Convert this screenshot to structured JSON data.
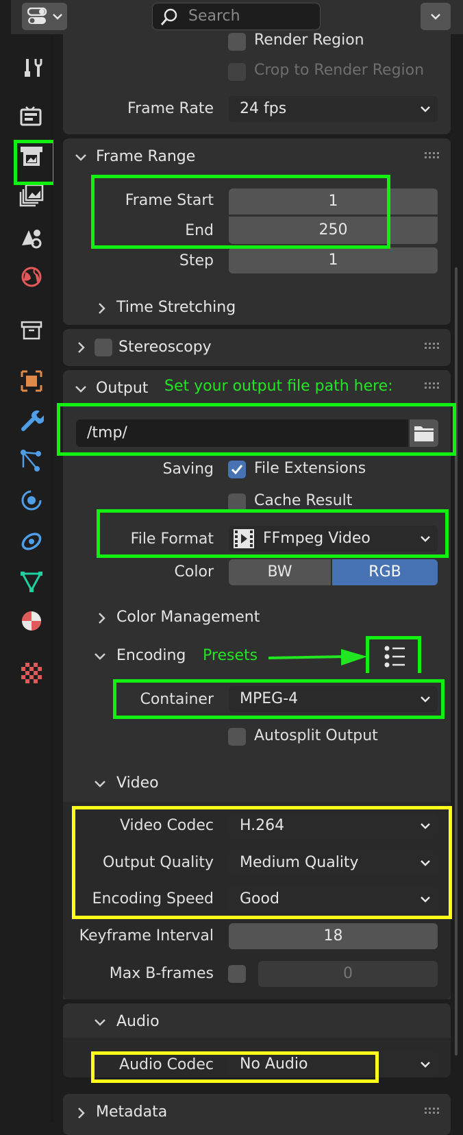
{
  "header": {
    "search_placeholder": "Search"
  },
  "render_region": {
    "render_region_label": "Render Region",
    "crop_label": "Crop to Render Region"
  },
  "format": {
    "frame_rate_label": "Frame Rate",
    "frame_rate_value": "24 fps"
  },
  "frame_range": {
    "title": "Frame Range",
    "start_label": "Frame Start",
    "start_value": "1",
    "end_label": "End",
    "end_value": "250",
    "step_label": "Step",
    "step_value": "1",
    "time_stretching": "Time Stretching"
  },
  "stereoscopy": {
    "title": "Stereoscopy"
  },
  "output": {
    "title": "Output",
    "annotation": "Set your output file path here:",
    "path": "/tmp/",
    "saving_label": "Saving",
    "file_extensions": "File Extensions",
    "cache_result": "Cache Result",
    "file_format_label": "File Format",
    "file_format_value": "FFmpeg Video",
    "color_label": "Color",
    "color_bw": "BW",
    "color_rgb": "RGB",
    "color_management": "Color Management"
  },
  "encoding": {
    "title": "Encoding",
    "presets_annotation": "Presets",
    "container_label": "Container",
    "container_value": "MPEG-4",
    "autosplit": "Autosplit Output"
  },
  "video": {
    "title": "Video",
    "codec_label": "Video Codec",
    "codec_value": "H.264",
    "quality_label": "Output Quality",
    "quality_value": "Medium Quality",
    "speed_label": "Encoding Speed",
    "speed_value": "Good",
    "keyframe_label": "Keyframe Interval",
    "keyframe_value": "18",
    "bframes_label": "Max B-frames",
    "bframes_value": "0"
  },
  "audio": {
    "title": "Audio",
    "codec_label": "Audio Codec",
    "codec_value": "No Audio"
  },
  "metadata": {
    "title": "Metadata"
  },
  "colors": {
    "highlight_green": "#12f012",
    "highlight_yellow": "#ffff1a",
    "accent_blue": "#4772b3"
  }
}
